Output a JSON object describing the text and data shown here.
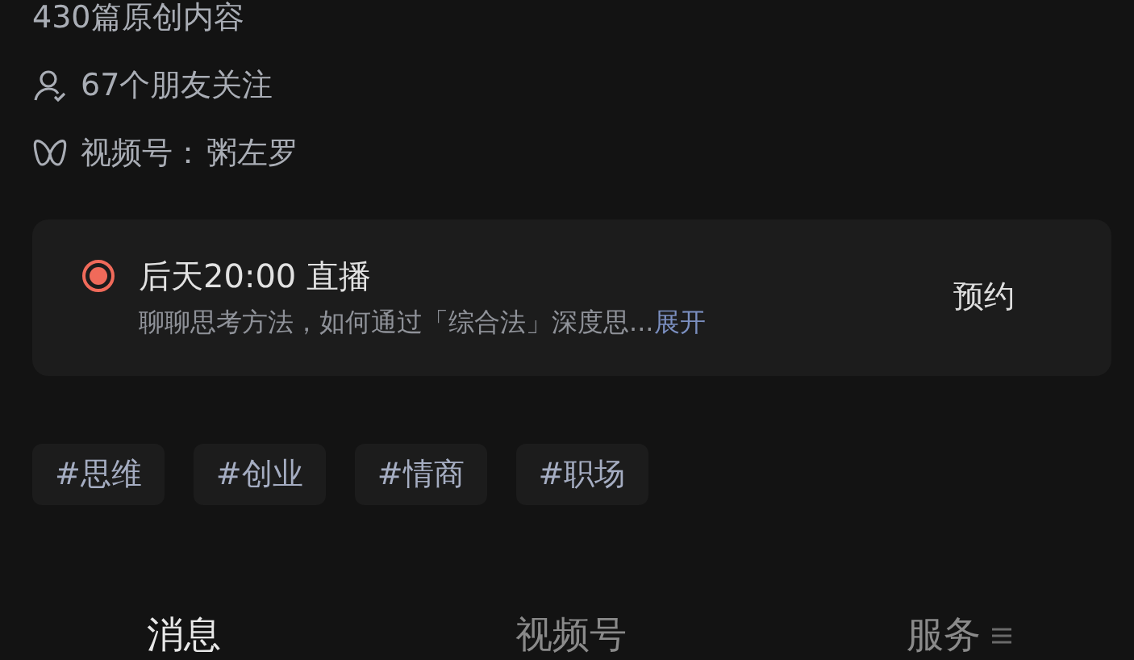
{
  "profile": {
    "articles": "430篇原创内容",
    "friends": "67个朋友关注",
    "channels_label": "视频号：",
    "channels_name": "粥左罗"
  },
  "live": {
    "title": "后天20:00 直播",
    "description": "聊聊思考方法，如何通过「综合法」深度思...",
    "expand": "展开",
    "button": "预约"
  },
  "tags": [
    "#思维",
    "#创业",
    "#情商",
    "#职场"
  ],
  "tabs": [
    {
      "label": "消息",
      "selected": true
    },
    {
      "label": "视频号",
      "selected": false
    },
    {
      "label": "服务",
      "selected": false,
      "menu": true
    }
  ]
}
